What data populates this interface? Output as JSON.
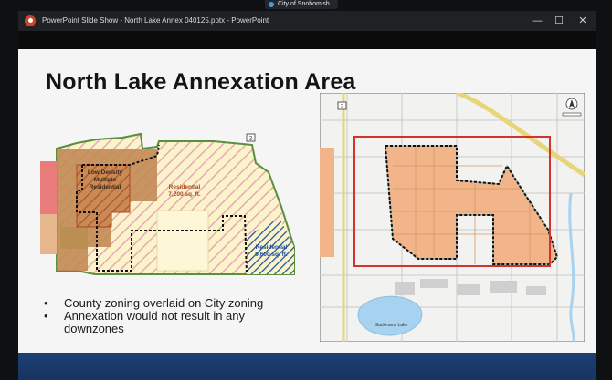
{
  "meeting": {
    "label": "City of Snohomish"
  },
  "window": {
    "title": "PowerPoint Slide Show  -  North Lake Annex 040125.pptx  -  PowerPoint",
    "controls": {
      "minimize": "—",
      "maximize": "☐",
      "close": "✕"
    }
  },
  "slide": {
    "title": "North Lake Annexation Area",
    "bullets": [
      "County zoning overlaid on City zoning",
      "Annexation would not result in any",
      "downzones"
    ],
    "left_map": {
      "labels": {
        "low_density": [
          "Low Density",
          "Multiple",
          "Residential"
        ],
        "residential_7200": [
          "Residential",
          "7,200 sq. ft."
        ],
        "residential_9600": [
          "Residential",
          "9,600 sq. ft."
        ],
        "road_shield": "2"
      }
    },
    "right_map": {
      "road_shield": "2",
      "lake_label": "Blackmans Lake"
    }
  },
  "colors": {
    "titlebar": "#202124",
    "slide_bg": "#f5f5f5",
    "annex_outline": "#d0342c",
    "annex_fill": "#f2b58a",
    "low_density": "#b5652e",
    "residential_7200": "#f3d3a5",
    "residential_9600": "#1f4e9c"
  }
}
